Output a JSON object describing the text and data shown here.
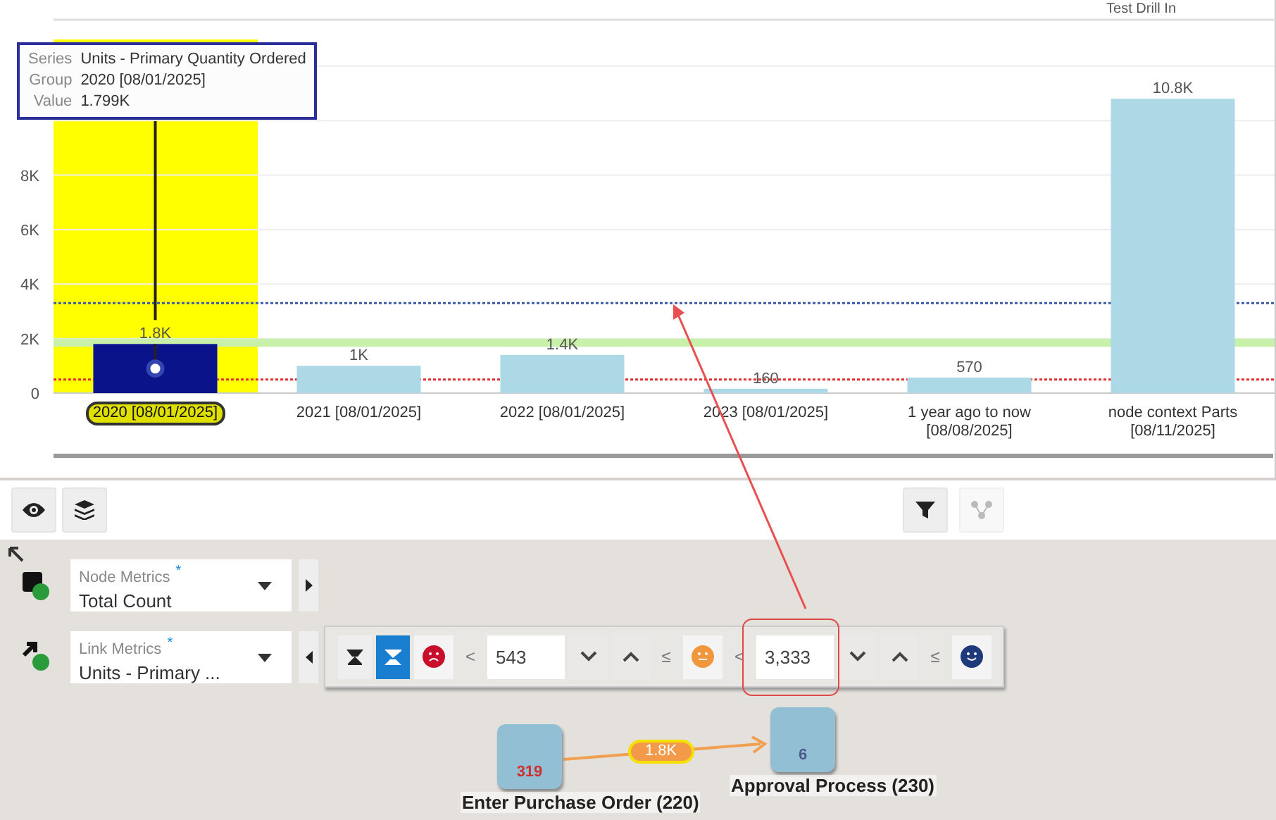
{
  "chart_panel": {
    "corner_label": "Test Drill In",
    "tooltip": {
      "series_key": "Series",
      "group_key": "Group",
      "value_key": "Value",
      "value": "1.799K"
    },
    "groups": [
      {
        "selected": true
      },
      {
        "selected": false
      },
      {
        "selected": false
      },
      {
        "selected": false
      },
      {
        "selected": false
      },
      {
        "selected": false
      }
    ],
    "chart_data": {
      "type": "bar",
      "categories": [
        "2020 [08/01/2025]",
        "2021 [08/01/2025]",
        "2022 [08/01/2025]",
        "2023 [08/01/2025]",
        "1 year ago to now [08/08/2025]",
        "node context Parts [08/11/2025]"
      ],
      "series": [
        {
          "name": "Units - Primary Quantity Ordered",
          "color": "#add8e6",
          "values": [
            1800,
            1000,
            1400,
            160,
            570,
            10800
          ]
        }
      ],
      "ylim": [
        0,
        13700
      ],
      "yticks": [
        {
          "value": 0,
          "label": "0"
        },
        {
          "value": 2000,
          "label": "2K"
        },
        {
          "value": 4000,
          "label": "4K"
        },
        {
          "value": 6000,
          "label": "6K"
        },
        {
          "value": 8000,
          "label": "8K"
        }
      ],
      "grid": true,
      "value_labels": [
        "1.8K",
        "1K",
        "1.4K",
        "160",
        "570",
        "10.8K"
      ],
      "bands": [
        {
          "axis": "y",
          "from": 1700,
          "to": 2000,
          "color": "#c8f0a8"
        }
      ],
      "ref_lines": [
        {
          "axis": "y",
          "value": 3300,
          "color": "#3b5ba5"
        },
        {
          "axis": "y",
          "value": 500,
          "color": "#e03030"
        }
      ]
    }
  },
  "toolbar": {
    "right_tools": [
      {
        "kind": "filter",
        "disabled": false
      },
      {
        "kind": "graph",
        "disabled": true
      }
    ]
  },
  "metrics": [
    {
      "kind": "node",
      "label": "Node Metrics",
      "marker": "*",
      "value": "Total Count",
      "expanded": false
    },
    {
      "kind": "link",
      "label": "Link Metrics",
      "marker": "*",
      "value": "Units - Primary ...",
      "expanded": true
    }
  ],
  "threshold_bar": [
    {
      "kind": "mode_top",
      "selected": false
    },
    {
      "kind": "mode_bottom",
      "selected": true
    },
    {
      "kind": "face_sad",
      "color": "#c8102e"
    },
    {
      "kind": "op",
      "text": "<"
    },
    {
      "kind": "field",
      "value": "543",
      "callout": false
    },
    {
      "kind": "step_down"
    },
    {
      "kind": "step_up"
    },
    {
      "kind": "op",
      "text": "≤"
    },
    {
      "kind": "face_neutral",
      "color": "#f0963c"
    },
    {
      "kind": "op",
      "text": "<"
    },
    {
      "kind": "field",
      "value": "3,333",
      "callout": true
    },
    {
      "kind": "step_down"
    },
    {
      "kind": "step_up"
    },
    {
      "kind": "op",
      "text": "≤"
    },
    {
      "kind": "face_happy",
      "color": "#1e3a7a"
    }
  ],
  "process_graph": {
    "nodes": [
      {
        "count": "319",
        "label": "Enter Purchase Order (220)",
        "color": "#d03030"
      },
      {
        "count": "6",
        "label": "Approval Process (230)",
        "color": "#4a5a8a"
      }
    ],
    "links": [
      {
        "label": "1.8K"
      }
    ]
  }
}
